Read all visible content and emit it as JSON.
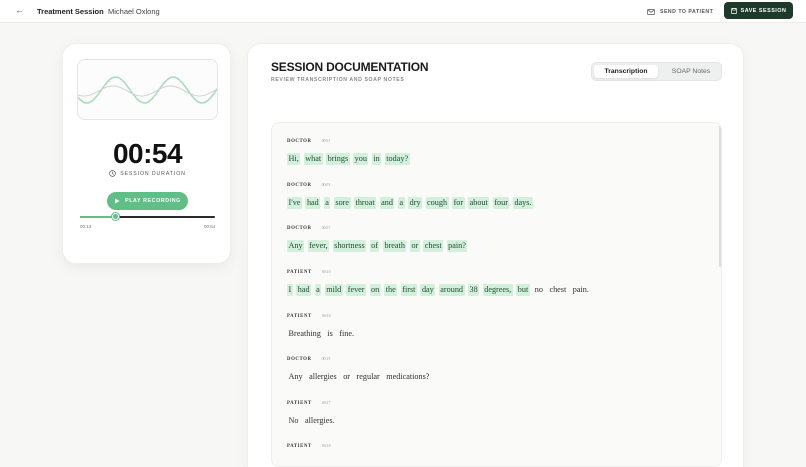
{
  "header": {
    "back_glyph": "←",
    "title": "Treatment Session",
    "patient": "Michael Oxlong",
    "send_label": "SEND TO PATIENT",
    "save_label": "SAVE SESSION"
  },
  "recorder": {
    "timer": "00:54",
    "timer_label": "SESSION DURATION",
    "play_label": "PLAY RECORDING",
    "elapsed": "00:13",
    "total": "00:54",
    "progress": 0.26
  },
  "documentation": {
    "title": "SESSION DOCUMENTATION",
    "subtitle": "REVIEW TRANSCRIPTION AND SOAP NOTES",
    "tabs": [
      {
        "label": "Transcription",
        "active": true
      },
      {
        "label": "SOAP Notes",
        "active": false
      }
    ],
    "entries": [
      {
        "speaker": "DOCTOR",
        "time": "00:01",
        "words": [
          "Hi,",
          "what",
          "brings",
          "you",
          "in",
          "today?"
        ],
        "highlight_count": 6
      },
      {
        "speaker": "DOCTOR",
        "time": "00:03",
        "words": [
          "I've",
          "had",
          "a",
          "sore",
          "throat",
          "and",
          "a",
          "dry",
          "cough",
          "for",
          "about",
          "four",
          "days."
        ],
        "highlight_count": 13
      },
      {
        "speaker": "DOCTOR",
        "time": "00:07",
        "words": [
          "Any",
          "fever,",
          "shortness",
          "of",
          "breath",
          "or",
          "chest",
          "pain?"
        ],
        "highlight_count": 8
      },
      {
        "speaker": "PATIENT",
        "time": "00:10",
        "words": [
          "I",
          "had",
          "a",
          "mild",
          "fever",
          "on",
          "the",
          "first",
          "day",
          "around",
          "38",
          "degrees,",
          "but",
          "no",
          "chest",
          "pain."
        ],
        "highlight_count": 13
      },
      {
        "speaker": "PATIENT",
        "time": "00:14",
        "words": [
          "Breathing",
          "is",
          "fine."
        ],
        "highlight_count": 0
      },
      {
        "speaker": "DOCTOR",
        "time": "00:15",
        "words": [
          "Any",
          "allergies",
          "or",
          "regular",
          "medications?"
        ],
        "highlight_count": 0
      },
      {
        "speaker": "PATIENT",
        "time": "00:17",
        "words": [
          "No",
          "allergies."
        ],
        "highlight_count": 0
      },
      {
        "speaker": "PATIENT",
        "time": "00:18",
        "words": [],
        "highlight_count": 0
      }
    ]
  },
  "colors": {
    "accent": "#5fbf86",
    "save_bg": "#1d3a2b",
    "highlight": "#d3f0dc"
  },
  "icons": {
    "back": "arrow-left-icon",
    "send": "mail-icon",
    "save": "save-icon",
    "clock": "clock-icon",
    "play": "play-icon"
  }
}
